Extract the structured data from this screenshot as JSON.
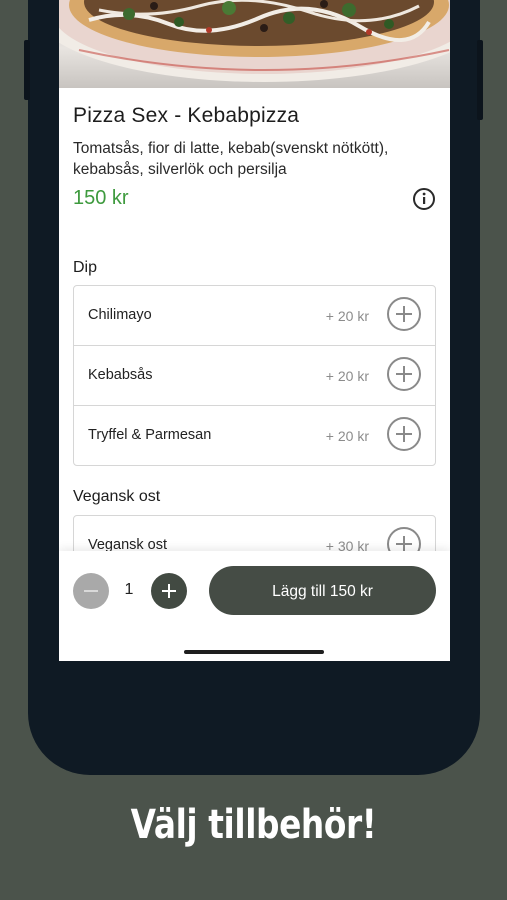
{
  "product": {
    "name": "Pizza Sex - Kebabpizza",
    "description": "Tomatsås, fior di latte, kebab(svenskt nötkött), kebabsås, silverlök och persilja",
    "price": "150 kr",
    "info_icon": "info-icon"
  },
  "sections": [
    {
      "title": "Dip",
      "options": [
        {
          "label": "Chilimayo",
          "price": "+ 20 kr"
        },
        {
          "label": "Kebabsås",
          "price": "+ 20 kr"
        },
        {
          "label": "Tryffel & Parmesan",
          "price": "+ 20 kr"
        }
      ]
    },
    {
      "title": "Vegansk ost",
      "options": [
        {
          "label": "Vegansk ost",
          "price": "+ 30 kr"
        }
      ]
    }
  ],
  "cart": {
    "quantity": "1",
    "add_button_label": "Lägg till 150 kr"
  },
  "caption": "Välj tillbehör!",
  "colors": {
    "background": "#4b534b",
    "accent_price": "#3e9a3e",
    "button_dark": "#454c45"
  }
}
